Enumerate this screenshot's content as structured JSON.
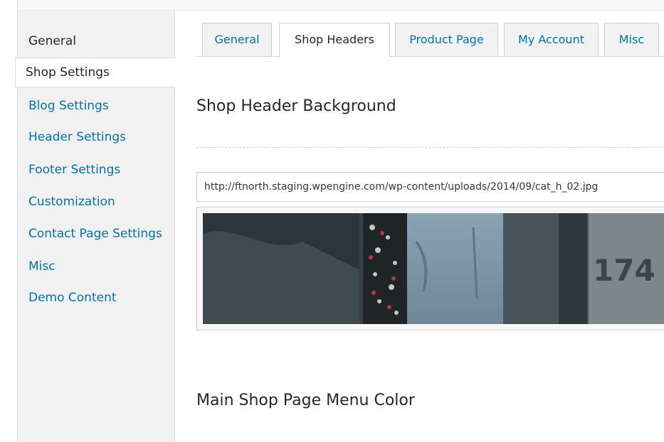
{
  "sidebar": {
    "items": [
      {
        "label": "General",
        "state": "plain"
      },
      {
        "label": "Shop Settings",
        "state": "active"
      },
      {
        "label": "Blog Settings",
        "state": "link"
      },
      {
        "label": "Header Settings",
        "state": "link"
      },
      {
        "label": "Footer Settings",
        "state": "link"
      },
      {
        "label": "Customization",
        "state": "link"
      },
      {
        "label": "Contact Page Settings",
        "state": "link"
      },
      {
        "label": "Misc",
        "state": "link"
      },
      {
        "label": "Demo Content",
        "state": "link"
      }
    ]
  },
  "tabs": [
    {
      "label": "General",
      "active": false
    },
    {
      "label": "Shop Headers",
      "active": true
    },
    {
      "label": "Product Page",
      "active": false
    },
    {
      "label": "My Account",
      "active": false
    },
    {
      "label": "Misc",
      "active": false
    }
  ],
  "shop_header": {
    "title": "Shop Header Background",
    "url_value": "http://ftnorth.staging.wpengine.com/wp-content/uploads/2014/09/cat_h_02.jpg",
    "preview_overlay_text": "174"
  },
  "menu_color": {
    "title": "Main Shop Page Menu Color"
  },
  "colors": {
    "link": "#0073aa",
    "text": "#23282d",
    "sidebar_bg": "#f1f1f1",
    "border": "#cfcfcf"
  }
}
